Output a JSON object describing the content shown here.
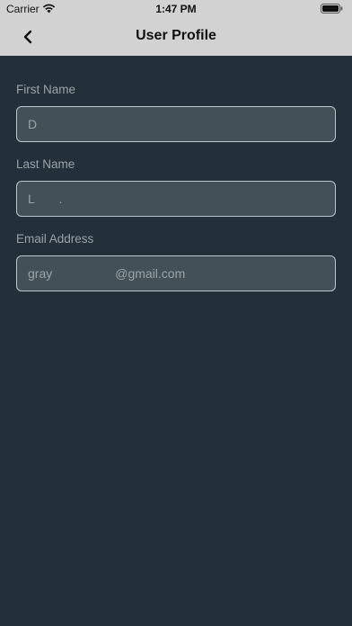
{
  "status_bar": {
    "carrier": "Carrier",
    "time": "1:47 PM",
    "icons": [
      "wifi-icon",
      "battery-icon"
    ]
  },
  "nav": {
    "title": "User Profile",
    "back_icon": "chevron-left-icon"
  },
  "form": {
    "first_name": {
      "label": "First Name",
      "value": "D"
    },
    "last_name": {
      "label": "Last Name",
      "value": "L       ."
    },
    "email": {
      "label": "Email Address",
      "value": "gray                  @gmail.com"
    }
  },
  "colors": {
    "background": "#233039",
    "header": "#d2d2d2",
    "input_bg": "#435058",
    "input_border": "#b9c6cc",
    "label": "#9aa3a8"
  }
}
